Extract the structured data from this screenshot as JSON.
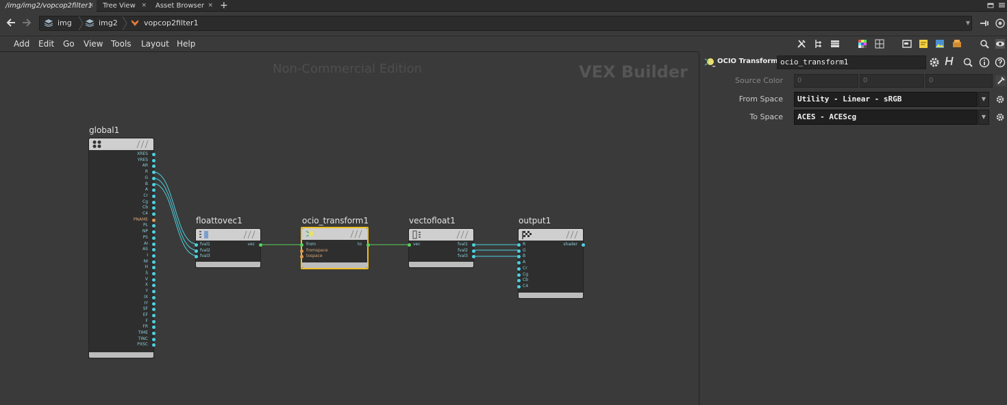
{
  "tabs": [
    {
      "label": "/img/img2/vopcop2filter1",
      "active": true,
      "close": "×"
    },
    {
      "label": "Tree View",
      "active": false,
      "close": "×"
    },
    {
      "label": "Asset Browser",
      "active": false,
      "close": "×"
    }
  ],
  "add_tab": "+",
  "breadcrumbs": [
    {
      "label": "img",
      "icon": "network-stack-icon"
    },
    {
      "label": "img2",
      "icon": "network-stack-icon"
    },
    {
      "label": "vopcop2filter1",
      "icon": "vop-filter-icon"
    }
  ],
  "menus": [
    "Add",
    "Edit",
    "Go",
    "View",
    "Tools",
    "Layout",
    "Help"
  ],
  "network": {
    "watermark": "Non-Commercial Edition",
    "context_label": "VEX Builder"
  },
  "nodes": {
    "global": {
      "title": "global1",
      "outputs": [
        "XRES",
        "YRES",
        "AR",
        "R",
        "G",
        "B",
        "A",
        "Cr",
        "Cg",
        "Cb",
        "C4",
        "PNAME",
        "PL",
        "NP",
        "PS",
        "AI",
        "AS",
        "I",
        "NI",
        "H",
        "S",
        "V",
        "X",
        "Y",
        "IX",
        "IY",
        "SF",
        "EF",
        "F",
        "FR",
        "TIME",
        "TINC",
        "PXSC"
      ]
    },
    "floattovec": {
      "title": "floattovec1",
      "inputs": [
        "fval1",
        "fval2",
        "fval3"
      ],
      "outputs": [
        "vec"
      ]
    },
    "ocio": {
      "title": "ocio_transform1",
      "inputs": [
        "from",
        "fromspace",
        "tospace"
      ],
      "outputs": [
        "to"
      ]
    },
    "vectofloat": {
      "title": "vectofloat1",
      "inputs": [
        "vec"
      ],
      "outputs": [
        "fval1",
        "fval2",
        "fval3"
      ]
    },
    "output": {
      "title": "output1",
      "inputs": [
        "R",
        "G",
        "B",
        "A",
        "Cr",
        "Cg",
        "Cb",
        "C4"
      ],
      "outputs": [
        "shader"
      ]
    }
  },
  "params": {
    "node_type": "OCIO Transform",
    "node_name": "ocio_transform1",
    "source_color": {
      "label": "Source Color",
      "values": [
        "0",
        "0",
        "0"
      ]
    },
    "from_space": {
      "label": "From Space",
      "value": "Utility - Linear - sRGB"
    },
    "to_space": {
      "label": "To Space",
      "value": "ACES - ACEScg"
    },
    "dropdown_glyph": "▼"
  },
  "colors": {
    "wire_cyan": "#4cd1e0",
    "wire_green": "#5bd15b",
    "selected_border": "#f0c020"
  }
}
